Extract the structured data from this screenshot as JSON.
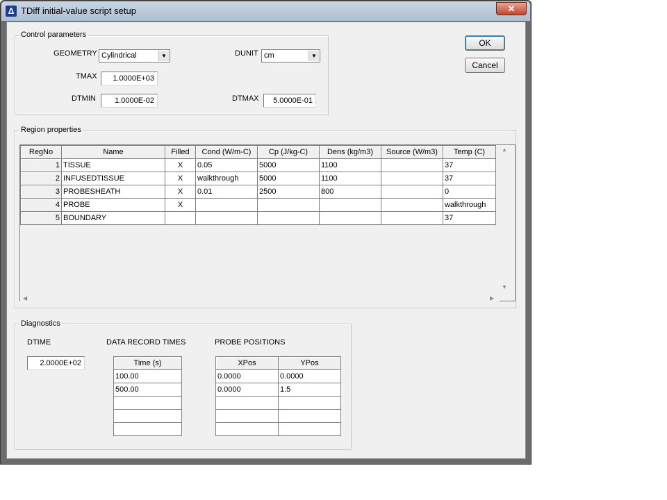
{
  "window": {
    "title": "TDiff initial-value script setup",
    "close_glyph": "✕",
    "icon": "tdiff-app-icon"
  },
  "buttons": {
    "ok": "OK",
    "cancel": "Cancel"
  },
  "control": {
    "group_title": "Control parameters",
    "geometry_label": "GEOMETRY",
    "geometry_value": "Cylindrical",
    "dunit_label": "DUNIT",
    "dunit_value": "cm",
    "tmax_label": "TMAX",
    "tmax_value": "1.0000E+03",
    "dtmin_label": "DTMIN",
    "dtmin_value": "1.0000E-02",
    "dtmax_label": "DTMAX",
    "dtmax_value": "5.0000E-01"
  },
  "region": {
    "group_title": "Region properties",
    "columns": [
      "RegNo",
      "Name",
      "Filled",
      "Cond (W/m-C)",
      "Cp (J/kg-C)",
      "Dens (kg/m3)",
      "Source (W/m3)",
      "Temp (C)"
    ],
    "rows": [
      [
        "1",
        "TISSUE",
        "X",
        "0.05",
        "5000",
        "1100",
        "",
        "37"
      ],
      [
        "2",
        "INFUSEDTISSUE",
        "X",
        "walkthrough",
        "5000",
        "1100",
        "",
        "37"
      ],
      [
        "3",
        "PROBESHEATH",
        "X",
        "0.01",
        "2500",
        "800",
        "",
        "0"
      ],
      [
        "4",
        "PROBE",
        "X",
        "",
        "",
        "",
        "",
        "walkthrough"
      ],
      [
        "5",
        "BOUNDARY",
        "",
        "",
        "",
        "",
        "",
        "37"
      ]
    ]
  },
  "diagnostics": {
    "group_title": "Diagnostics",
    "dtime_label": "DTIME",
    "dtime_value": "2.0000E+02",
    "record_label": "DATA RECORD TIMES",
    "record_column": "Time (s)",
    "record_rows": [
      "100.00",
      "500.00",
      "",
      "",
      ""
    ],
    "probe_label": "PROBE POSITIONS",
    "probe_columns": [
      "XPos",
      "YPos"
    ],
    "probe_rows": [
      [
        "0.0000",
        "0.0000"
      ],
      [
        "0.0000",
        "1.5"
      ],
      [
        "",
        ""
      ],
      [
        "",
        ""
      ],
      [
        "",
        ""
      ]
    ]
  }
}
